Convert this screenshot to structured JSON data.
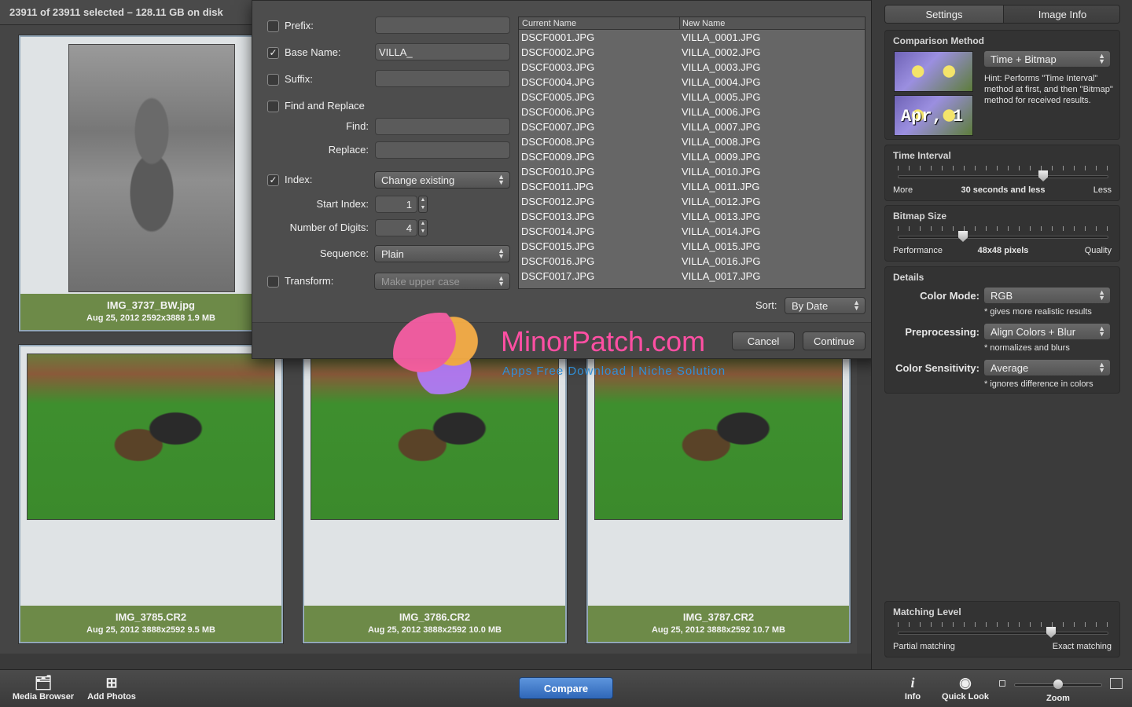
{
  "status": {
    "selection": "23911 of 23911 selected – 128.11 GB on disk"
  },
  "cards": [
    {
      "name": "IMG_3737_BW.jpg",
      "meta": "Aug 25, 2012  2592x3888  1.9 MB"
    },
    {
      "name": "IMG_3785.CR2",
      "meta": "Aug 25, 2012  3888x2592  9.5 MB"
    },
    {
      "name": "IMG_3786.CR2",
      "meta": "Aug 25, 2012  3888x2592  10.0 MB"
    },
    {
      "name": "IMG_3787.CR2",
      "meta": "Aug 25, 2012  3888x2592  10.7 MB"
    }
  ],
  "rename": {
    "prefix": {
      "label": "Prefix:",
      "checked": false,
      "value": ""
    },
    "base_name": {
      "label": "Base Name:",
      "checked": true,
      "value": "VILLA_"
    },
    "suffix": {
      "label": "Suffix:",
      "checked": false,
      "value": ""
    },
    "find_replace": {
      "label": "Find and Replace",
      "checked": false,
      "find_label": "Find:",
      "replace_label": "Replace:",
      "find_value": "",
      "replace_value": ""
    },
    "index": {
      "label": "Index:",
      "checked": true,
      "mode": "Change existing"
    },
    "start_index": {
      "label": "Start Index:",
      "value": "1"
    },
    "digits": {
      "label": "Number of Digits:",
      "value": "4"
    },
    "sequence": {
      "label": "Sequence:",
      "value": "Plain"
    },
    "transform": {
      "label": "Transform:",
      "checked": false,
      "value": "Make upper case"
    },
    "columns": {
      "current": "Current Name",
      "new": "New Name"
    },
    "rows": [
      {
        "current": "DSCF0001.JPG",
        "new": "VILLA_0001.JPG"
      },
      {
        "current": "DSCF0002.JPG",
        "new": "VILLA_0002.JPG"
      },
      {
        "current": "DSCF0003.JPG",
        "new": "VILLA_0003.JPG"
      },
      {
        "current": "DSCF0004.JPG",
        "new": "VILLA_0004.JPG"
      },
      {
        "current": "DSCF0005.JPG",
        "new": "VILLA_0005.JPG"
      },
      {
        "current": "DSCF0006.JPG",
        "new": "VILLA_0006.JPG"
      },
      {
        "current": "DSCF0007.JPG",
        "new": "VILLA_0007.JPG"
      },
      {
        "current": "DSCF0008.JPG",
        "new": "VILLA_0008.JPG"
      },
      {
        "current": "DSCF0009.JPG",
        "new": "VILLA_0009.JPG"
      },
      {
        "current": "DSCF0010.JPG",
        "new": "VILLA_0010.JPG"
      },
      {
        "current": "DSCF0011.JPG",
        "new": "VILLA_0011.JPG"
      },
      {
        "current": "DSCF0012.JPG",
        "new": "VILLA_0012.JPG"
      },
      {
        "current": "DSCF0013.JPG",
        "new": "VILLA_0013.JPG"
      },
      {
        "current": "DSCF0014.JPG",
        "new": "VILLA_0014.JPG"
      },
      {
        "current": "DSCF0015.JPG",
        "new": "VILLA_0015.JPG"
      },
      {
        "current": "DSCF0016.JPG",
        "new": "VILLA_0016.JPG"
      },
      {
        "current": "DSCF0017.JPG",
        "new": "VILLA_0017.JPG"
      }
    ],
    "sort_label": "Sort:",
    "sort_value": "By Date",
    "cancel": "Cancel",
    "continue": "Continue"
  },
  "watermark": {
    "title": "MinorPatch.com",
    "subtitle": "Apps Free Download | Niche Solution"
  },
  "inspector": {
    "tabs": [
      "Settings",
      "Image Info"
    ],
    "comparison": {
      "title": "Comparison Method",
      "method": "Time + Bitmap",
      "hint": "Hint: Performs \"Time Interval\" method at first, and then \"Bitmap\" method for received results.",
      "thumb_date": "Apr, 1"
    },
    "time_interval": {
      "title": "Time Interval",
      "left": "More",
      "center": "30 seconds and less",
      "right": "Less",
      "level": 0.7
    },
    "bitmap_size": {
      "title": "Bitmap Size",
      "left": "Performance",
      "center": "48x48 pixels",
      "right": "Quality",
      "level": 0.3
    },
    "details": {
      "title": "Details",
      "color_mode": {
        "label": "Color Mode:",
        "value": "RGB",
        "hint": "* gives more realistic results"
      },
      "preprocessing": {
        "label": "Preprocessing:",
        "value": "Align Colors + Blur",
        "hint": "* normalizes and blurs"
      },
      "sensitivity": {
        "label": "Color Sensitivity:",
        "value": "Average",
        "hint": "* ignores difference in colors"
      }
    },
    "matching": {
      "title": "Matching Level",
      "left": "Partial matching",
      "right": "Exact matching",
      "level": 0.74
    }
  },
  "toolbar": {
    "media_browser": "Media Browser",
    "add_photos": "Add Photos",
    "compare": "Compare",
    "info": "Info",
    "quick_look": "Quick Look",
    "zoom": "Zoom"
  },
  "colors": {
    "caption_green": "#6d8a48",
    "compare_blue": "#3a74c4"
  }
}
